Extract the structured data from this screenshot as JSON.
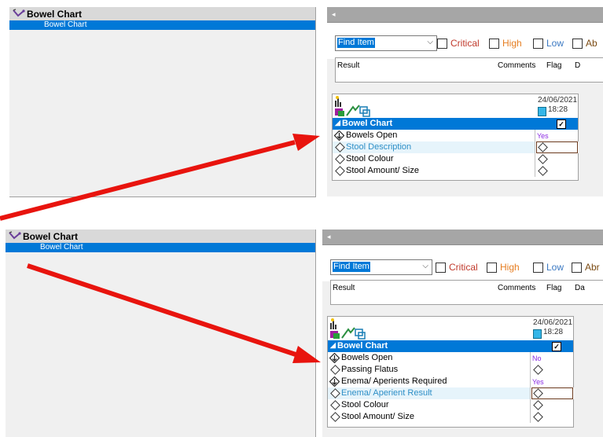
{
  "tree": {
    "header": "Bowel Chart",
    "selected_item": "Bowel Chart"
  },
  "filter": {
    "find_item": "Find Item",
    "options": [
      {
        "label": "Critical",
        "color": "#c0392b"
      },
      {
        "label": "High",
        "color": "#e67e22"
      },
      {
        "label": "Low",
        "color": "#3a78c2"
      },
      {
        "label": "Ab",
        "color": "#7a4a12"
      }
    ]
  },
  "grid": {
    "columns": [
      "Result",
      "Comments",
      "Flag",
      "D"
    ]
  },
  "panel_top": {
    "date": "24/06/2021",
    "time": "18:28",
    "group": "Bowel Chart",
    "rows": [
      {
        "name": "Bowels Open",
        "value": "Yes",
        "style": "entered"
      },
      {
        "name": "Stool Description",
        "value": "",
        "style": "active"
      },
      {
        "name": "Stool Colour",
        "value": "",
        "style": "plain"
      },
      {
        "name": "Stool Amount/ Size",
        "value": "",
        "style": "plain"
      }
    ]
  },
  "panel_bottom": {
    "date": "24/06/2021",
    "time": "18:28",
    "group": "Bowel Chart",
    "rows": [
      {
        "name": "Bowels Open",
        "value": "No",
        "style": "entered"
      },
      {
        "name": "Passing Flatus",
        "value": "",
        "style": "plain"
      },
      {
        "name": "Enema/ Aperients Required",
        "value": "Yes",
        "style": "entered"
      },
      {
        "name": "Enema/ Aperient Result",
        "value": "",
        "style": "active"
      },
      {
        "name": "Stool Colour",
        "value": "",
        "style": "plain"
      },
      {
        "name": "Stool Amount/ Size",
        "value": "",
        "style": "plain"
      }
    ]
  },
  "bottom_filter_last": "Abr",
  "bottom_grid_last": "Da",
  "colors": {
    "selection": "#0078d7",
    "arrow": "#e8140e",
    "value_text": "#8a2be2"
  }
}
